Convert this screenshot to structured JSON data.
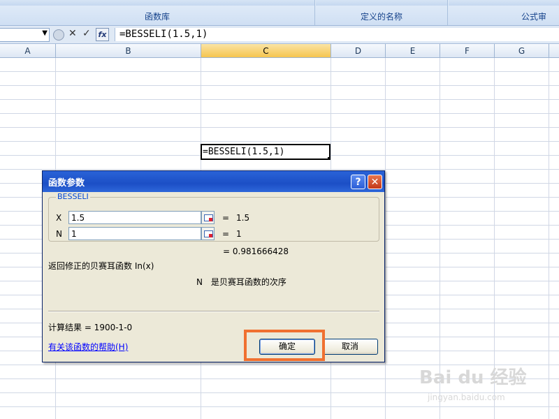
{
  "ribbon": {
    "groups": [
      {
        "label": "函数库"
      },
      {
        "label": "定义的名称"
      },
      {
        "label": "公式审"
      }
    ]
  },
  "formula_bar": {
    "name_box": "",
    "cancel_icon": "✕",
    "enter_icon": "✓",
    "fx_label": "fx",
    "formula": "=BESSELI(1.5,1)"
  },
  "columns": [
    "A",
    "B",
    "C",
    "D",
    "E",
    "F",
    "G"
  ],
  "active_cell": {
    "value": "=BESSELI(1.5,1)"
  },
  "dialog": {
    "title": "函数参数",
    "help_btn": "?",
    "close_btn": "✕",
    "function_name": "BESSELI",
    "args": [
      {
        "name": "X",
        "value": "1.5",
        "eq": "=",
        "result": "1.5"
      },
      {
        "name": "N",
        "value": "1",
        "eq": "=",
        "result": "1"
      }
    ],
    "result": "= 0.981666428",
    "description": "返回修正的贝赛耳函数 In(x)",
    "param_name": "N",
    "param_description": "是贝赛耳函数的次序",
    "calc_result": "计算结果 = 1900-1-0",
    "help_link": "有关该函数的帮助(H)",
    "ok_label": "确定",
    "cancel_label": "取消"
  },
  "watermark": {
    "text": "Bai du 经验",
    "sub": "jingyan.baidu.com"
  }
}
